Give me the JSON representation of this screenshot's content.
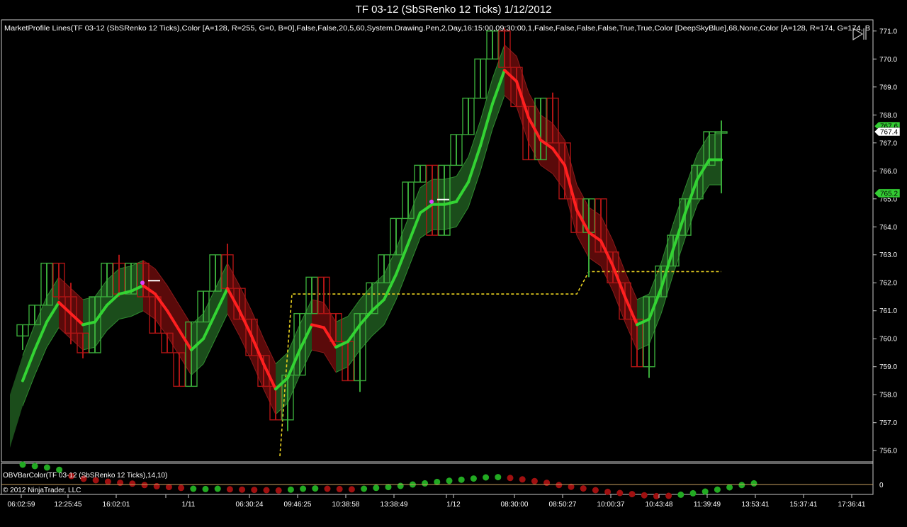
{
  "window": {
    "title": "TF 03-12 (SbSRenko 12 Ticks)  1/12/2012"
  },
  "indicator_label": "MarketProfile Lines(TF  03-12  (SbSRenko  12  Ticks),Color  [A=128,  R=255,  G=0,  B=0],False,False,20,5,60,System.Drawing.Pen,2,Day,16:15:00,09:30:00,1,False,False,False,False,True,True,Color  [DeepSkyBlue],68,None,Color  [A=128,  R=174,  G=174,  B",
  "sub_panel_label": "OBVBarColor(TF 03-12 (SbSRenko 12 Ticks),14,10)",
  "copyright": "© 2012 NinjaTrader, LLC",
  "colors": {
    "up": "#3aaa3a",
    "down": "#b01515",
    "band_up": "#1b4d1b",
    "band_down": "#5a0a0a",
    "ma_up": "#33d433",
    "ma_down": "#ff2020",
    "level": "#e8d020",
    "price_box_green": "#33cc33"
  },
  "chart_data": [
    {
      "type": "candlestick",
      "title": "TF 03-12 (SbSRenko 12 Ticks)  1/12/2012",
      "ylim": [
        755.6,
        771.4
      ],
      "y_ticks": [
        "771.0",
        "770.0",
        "769.0",
        "768.0",
        "767.0",
        "766.0",
        "765.0",
        "764.0",
        "763.0",
        "762.0",
        "761.0",
        "760.0",
        "759.0",
        "758.0",
        "757.0",
        "756.0"
      ],
      "x_ticks": [
        "06:02:59",
        "12:25:45",
        "16:02:01",
        "1/11",
        "06:30:24",
        "09:46:25",
        "10:38:58",
        "13:38:49",
        "1/12",
        "08:30:00",
        "08:50:27",
        "10:00:37",
        "10:43:48",
        "11:39:49",
        "13:53:41",
        "15:37:41",
        "17:36:41"
      ],
      "price_markers": [
        "767.6",
        "767.4",
        "765.2"
      ],
      "bars_ohlc": [
        [
          760.1,
          760.5,
          759.6,
          760.5
        ],
        [
          760.5,
          761.2,
          760.5,
          761.2
        ],
        [
          761.2,
          762.7,
          761.2,
          762.7
        ],
        [
          762.7,
          762.7,
          761.4,
          761.5
        ],
        [
          761.5,
          762.0,
          759.8,
          760.2
        ],
        [
          760.2,
          760.2,
          759.3,
          759.5
        ],
        [
          759.5,
          761.5,
          759.5,
          761.5
        ],
        [
          761.5,
          762.7,
          761.5,
          762.7
        ],
        [
          762.7,
          763.0,
          761.5,
          761.6
        ],
        [
          761.6,
          762.7,
          761.6,
          762.7
        ],
        [
          762.7,
          762.8,
          761.5,
          761.5
        ],
        [
          761.5,
          761.5,
          760.2,
          760.2
        ],
        [
          760.2,
          760.2,
          759.5,
          759.5
        ],
        [
          759.5,
          759.5,
          758.3,
          758.3
        ],
        [
          758.3,
          760.6,
          758.3,
          760.6
        ],
        [
          760.6,
          761.7,
          760.6,
          761.7
        ],
        [
          761.7,
          763.0,
          761.7,
          763.0
        ],
        [
          763.0,
          763.4,
          761.8,
          761.8
        ],
        [
          761.8,
          761.8,
          760.7,
          760.7
        ],
        [
          760.7,
          760.7,
          759.4,
          759.4
        ],
        [
          759.4,
          759.4,
          758.3,
          758.3
        ],
        [
          758.3,
          758.3,
          757.1,
          757.1
        ],
        [
          757.1,
          758.7,
          756.7,
          758.7
        ],
        [
          758.7,
          760.9,
          758.7,
          760.9
        ],
        [
          760.9,
          762.2,
          760.9,
          762.2
        ],
        [
          762.2,
          762.2,
          760.9,
          760.9
        ],
        [
          760.9,
          760.9,
          759.9,
          759.9
        ],
        [
          759.9,
          759.9,
          758.5,
          758.5
        ],
        [
          758.5,
          760.9,
          758.1,
          760.9
        ],
        [
          760.9,
          762.0,
          760.9,
          762.0
        ],
        [
          762.0,
          763.0,
          762.0,
          763.0
        ],
        [
          763.0,
          764.3,
          763.0,
          764.3
        ],
        [
          764.3,
          765.6,
          764.3,
          765.6
        ],
        [
          765.6,
          766.2,
          765.6,
          766.2
        ],
        [
          766.2,
          766.2,
          763.7,
          763.7
        ],
        [
          763.7,
          766.2,
          763.7,
          766.2
        ],
        [
          766.2,
          767.3,
          766.2,
          767.3
        ],
        [
          767.3,
          768.6,
          767.3,
          768.6
        ],
        [
          768.6,
          770.0,
          768.6,
          770.0
        ],
        [
          770.0,
          771.0,
          770.0,
          771.0
        ],
        [
          771.0,
          771.1,
          769.7,
          769.7
        ],
        [
          769.7,
          769.7,
          768.3,
          768.3
        ],
        [
          768.3,
          768.3,
          766.4,
          766.4
        ],
        [
          766.4,
          768.6,
          766.4,
          768.6
        ],
        [
          768.6,
          768.8,
          767.0,
          767.0
        ],
        [
          767.0,
          767.0,
          765.0,
          765.0
        ],
        [
          765.0,
          765.0,
          763.8,
          763.8
        ],
        [
          763.8,
          765.0,
          762.2,
          765.0
        ],
        [
          765.0,
          765.0,
          763.1,
          763.1
        ],
        [
          763.1,
          763.1,
          762.0,
          762.0
        ],
        [
          762.0,
          762.0,
          760.7,
          760.7
        ],
        [
          760.7,
          760.7,
          759.0,
          759.0
        ],
        [
          759.0,
          761.5,
          758.6,
          761.5
        ],
        [
          761.5,
          762.6,
          761.5,
          762.6
        ],
        [
          762.6,
          763.7,
          762.6,
          763.7
        ],
        [
          763.7,
          765.0,
          763.7,
          765.0
        ],
        [
          765.0,
          766.2,
          765.0,
          766.2
        ],
        [
          766.2,
          767.4,
          766.2,
          767.4
        ],
        [
          767.4,
          767.8,
          765.2,
          767.4
        ]
      ],
      "moving_average": [
        758.5,
        759.6,
        760.6,
        761.3,
        760.9,
        760.5,
        760.6,
        761.2,
        761.6,
        761.7,
        761.9,
        761.6,
        761.0,
        760.3,
        759.6,
        760.0,
        760.9,
        761.8,
        761.0,
        760.1,
        759.1,
        758.2,
        758.6,
        759.6,
        760.5,
        760.4,
        759.7,
        759.9,
        760.5,
        761.0,
        761.4,
        762.3,
        763.4,
        764.5,
        764.8,
        764.8,
        764.9,
        765.6,
        766.9,
        768.4,
        769.6,
        769.2,
        767.9,
        767.1,
        766.8,
        766.2,
        764.6,
        763.8,
        763.5,
        762.6,
        761.5,
        760.5,
        760.7,
        761.8,
        763.2,
        764.5,
        765.7,
        766.4,
        766.4
      ],
      "dotted_level": [
        {
          "from_bar": 22,
          "to_bar": 22,
          "value": 755.8
        },
        {
          "from_bar": 23,
          "to_bar": 46,
          "value": 761.6
        },
        {
          "from_bar": 47,
          "to_bar": 58,
          "value": 762.4
        }
      ],
      "markers": [
        {
          "bar": 10,
          "value": 762.0,
          "color": "#e040ff"
        },
        {
          "bar": 34,
          "value": 764.9,
          "color": "#e040ff"
        }
      ]
    },
    {
      "type": "scatter",
      "title": "OBVBarColor(TF 03-12 (SbSRenko 12 Ticks),14,10)",
      "y_ticks": [
        "0"
      ],
      "dots": [
        1,
        1,
        1,
        1,
        -1,
        -1,
        -1,
        -1,
        -1,
        -1,
        -1,
        -1,
        -1,
        -1,
        1,
        1,
        1,
        -1,
        -1,
        -1,
        -1,
        -1,
        1,
        1,
        1,
        -1,
        -1,
        -1,
        1,
        1,
        1,
        1,
        1,
        1,
        1,
        1,
        1,
        1,
        1,
        1,
        -1,
        -1,
        -1,
        -1,
        -1,
        -1,
        -1,
        -1,
        -1,
        -1,
        -1,
        -1,
        -1,
        -1,
        1,
        1,
        1,
        1,
        1,
        1,
        1
      ],
      "obv": [
        700,
        650,
        600,
        520,
        300,
        200,
        150,
        100,
        60,
        30,
        -20,
        -60,
        -90,
        -120,
        -150,
        -160,
        -150,
        -170,
        -180,
        -190,
        -200,
        -210,
        -180,
        -150,
        -140,
        -150,
        -160,
        -170,
        -150,
        -120,
        -90,
        -50,
        0,
        40,
        90,
        130,
        170,
        210,
        250,
        260,
        230,
        180,
        120,
        60,
        -20,
        -80,
        -140,
        -200,
        -260,
        -300,
        -340,
        -380,
        -410,
        -400,
        -360,
        -310,
        -250,
        -180,
        -100,
        -20,
        40
      ]
    }
  ]
}
